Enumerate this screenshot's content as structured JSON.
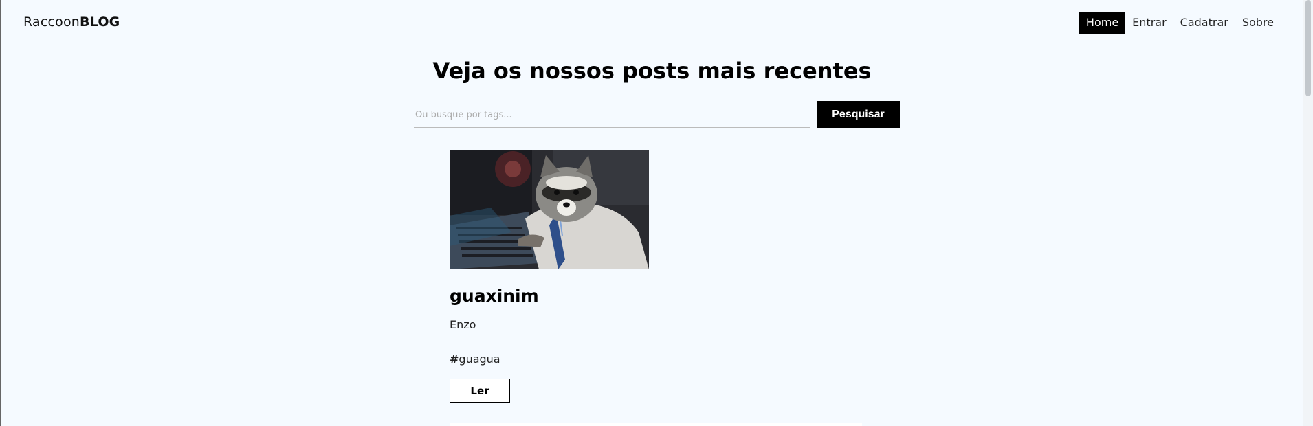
{
  "navbar": {
    "brand_light": "Raccoon",
    "brand_bold": "BLOG",
    "links": [
      {
        "label": "Home",
        "active": true
      },
      {
        "label": "Entrar",
        "active": false
      },
      {
        "label": "Cadatrar",
        "active": false
      },
      {
        "label": "Sobre",
        "active": false
      }
    ]
  },
  "main": {
    "title": "Veja os nossos posts mais recentes",
    "search": {
      "placeholder": "Ou busque por tags...",
      "value": "",
      "button_label": "Pesquisar"
    },
    "posts": [
      {
        "image_alt": "raccoon at a computer keyboard",
        "title": "guaxinim",
        "author": "Enzo",
        "tag_symbol": "#",
        "tag": "guagua",
        "read_label": "Ler"
      }
    ]
  },
  "colors": {
    "background": "#f5faff",
    "accent": "#000000",
    "active_nav_text": "#ffffff"
  }
}
